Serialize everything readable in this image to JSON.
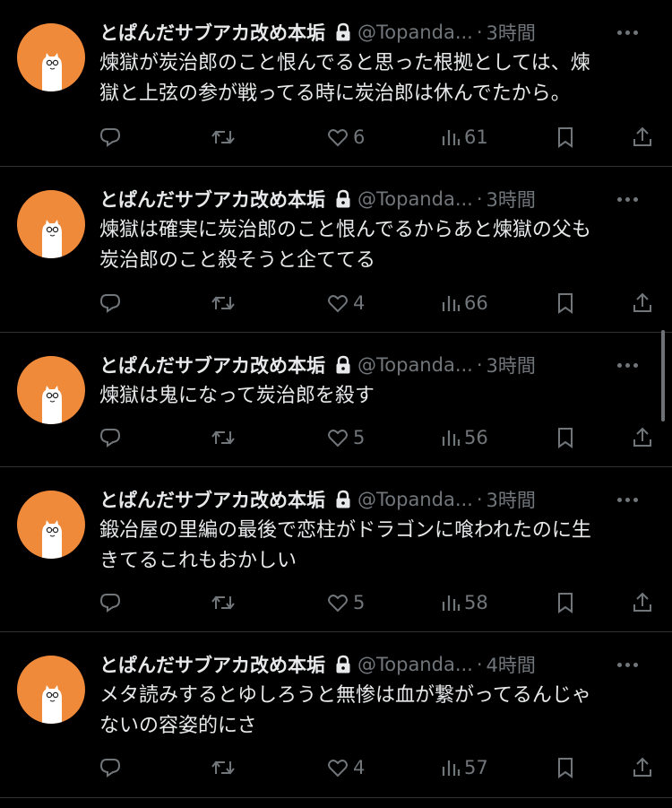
{
  "tweets": [
    {
      "name": "とぱんだサブアカ改め本垢",
      "handle": "@Topanda...",
      "separator": "·",
      "time": "3時間",
      "text": "煉獄が炭治郎のこと恨んでると思った根拠としては、煉\n獄と上弦の参が戦ってる時に炭治郎は休んでたから。",
      "likes": "6",
      "views": "61"
    },
    {
      "name": "とぱんだサブアカ改め本垢",
      "handle": "@Topanda...",
      "separator": "·",
      "time": "3時間",
      "text": "煉獄は確実に炭治郎のこと恨んでるからあと煉獄の父も\n炭治郎のこと殺そうと企ててる",
      "likes": "4",
      "views": "66"
    },
    {
      "name": "とぱんだサブアカ改め本垢",
      "handle": "@Topanda...",
      "separator": "·",
      "time": "3時間",
      "text": "煉獄は鬼になって炭治郎を殺す",
      "likes": "5",
      "views": "56"
    },
    {
      "name": "とぱんだサブアカ改め本垢",
      "handle": "@Topanda...",
      "separator": "·",
      "time": "3時間",
      "text": "鍛冶屋の里編の最後で恋柱がドラゴンに喰われたのに生\nきてるこれもおかしい",
      "likes": "5",
      "views": "58"
    },
    {
      "name": "とぱんだサブアカ改め本垢",
      "handle": "@Topanda...",
      "separator": "·",
      "time": "4時間",
      "text": "メタ読みするとゆしろうと無惨は血が繋がってるんじゃ\nないの容姿的にさ",
      "likes": "4",
      "views": "57"
    }
  ],
  "colors": {
    "background": "#000000",
    "text_primary": "#e7e9ea",
    "text_secondary": "#71767b",
    "divider": "#2f3336",
    "avatar": "#f08a3b"
  },
  "icons": [
    "lock-icon",
    "more-icon",
    "reply-icon",
    "retweet-icon",
    "like-icon",
    "views-icon",
    "bookmark-icon",
    "share-icon"
  ]
}
